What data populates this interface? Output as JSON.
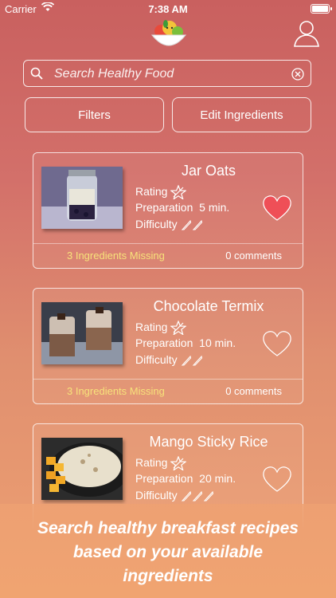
{
  "status_bar": {
    "carrier": "Carrier",
    "time": "7:38 AM"
  },
  "search": {
    "placeholder": "Search Healthy Food"
  },
  "buttons": {
    "filters": "Filters",
    "edit_ingredients": "Edit Ingredients"
  },
  "recipes": [
    {
      "title": "Jar Oats",
      "rating_label": "Rating",
      "preparation_label": "Preparation",
      "preparation_time": "5 min.",
      "difficulty_label": "Difficulty",
      "difficulty_level": 2,
      "favorite": true,
      "missing": "3 Ingredients Missing",
      "comments": "0 comments"
    },
    {
      "title": "Chocolate Termix",
      "rating_label": "Rating",
      "preparation_label": "Preparation",
      "preparation_time": "10 min.",
      "difficulty_label": "Difficulty",
      "difficulty_level": 2,
      "favorite": false,
      "missing": "3 Ingredients Missing",
      "comments": "0 comments"
    },
    {
      "title": "Mango Sticky Rice",
      "rating_label": "Rating",
      "preparation_label": "Preparation",
      "preparation_time": "20 min.",
      "difficulty_label": "Difficulty",
      "difficulty_level": 3,
      "favorite": false
    }
  ],
  "caption": {
    "line1": "Search healthy breakfast recipes",
    "line2": "based on your available",
    "line3": "ingredients"
  },
  "colors": {
    "heart_filled": "#ef4f57",
    "missing_text": "#f7e27a"
  },
  "icons": {
    "logo": "fruit-bowl-icon",
    "profile": "user-icon",
    "search": "search-icon",
    "clear": "clear-icon",
    "rating": "star-icon",
    "difficulty": "knife-icon",
    "favorite": "heart-icon"
  }
}
